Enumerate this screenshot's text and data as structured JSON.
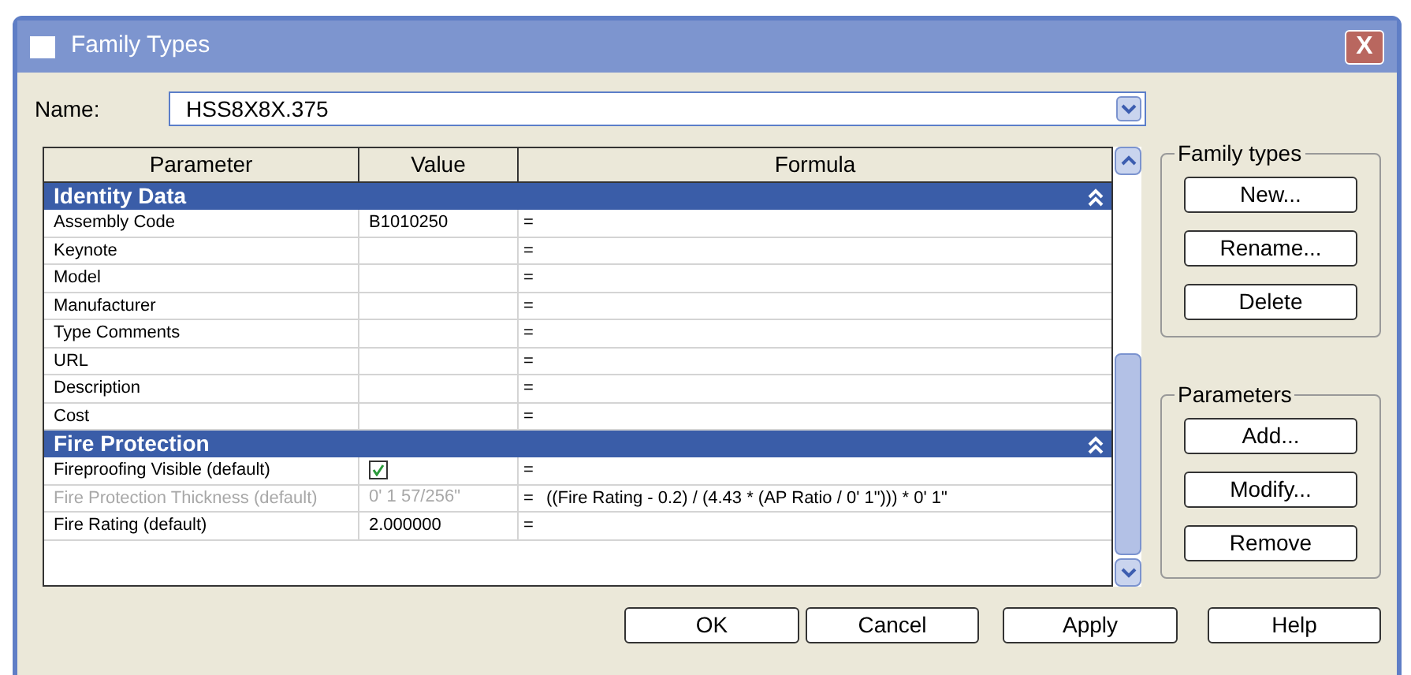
{
  "window": {
    "title": "Family Types",
    "close": "X"
  },
  "name_field": {
    "label": "Name:",
    "value": "HSS8X8X.375"
  },
  "table": {
    "columns": [
      "Parameter",
      "Value",
      "Formula"
    ],
    "groups": [
      {
        "title": "Identity Data",
        "expanded": true,
        "rows": [
          {
            "kind": "text",
            "parameter": "Assembly Code",
            "value": "B1010250",
            "formula": "=",
            "disabled": false
          },
          {
            "kind": "text",
            "parameter": "Keynote",
            "formula": "=",
            "disabled": false
          },
          {
            "kind": "text",
            "parameter": "Model",
            "formula": "=",
            "disabled": false
          },
          {
            "kind": "text",
            "parameter": "Manufacturer",
            "formula": "=",
            "disabled": false
          },
          {
            "kind": "text",
            "parameter": "Type Comments",
            "formula": "=",
            "disabled": false
          },
          {
            "kind": "text",
            "parameter": "URL",
            "formula": "=",
            "disabled": false
          },
          {
            "kind": "text",
            "parameter": "Description",
            "formula": "=",
            "disabled": false
          },
          {
            "kind": "text",
            "parameter": "Cost",
            "formula": "=",
            "disabled": false
          }
        ]
      },
      {
        "title": "Fire Protection",
        "expanded": true,
        "rows": [
          {
            "kind": "checkbox",
            "parameter": "Fireproofing Visible (default)",
            "checked": true,
            "formula": "=",
            "disabled": false
          },
          {
            "kind": "text",
            "parameter": "Fire Protection Thickness (default)",
            "value": "0' 1 57/256\"",
            "formula": "=",
            "expression": "((Fire Rating - 0.2) / (4.43 * (AP Ratio / 0' 1\"))) * 0' 1\"",
            "disabled": true
          },
          {
            "kind": "text",
            "parameter": "Fire Rating (default)",
            "value": "2.000000",
            "formula": "=",
            "disabled": false
          }
        ]
      }
    ]
  },
  "family_types": {
    "title": "Family types",
    "buttons": [
      "New...",
      "Rename...",
      "Delete"
    ]
  },
  "parameters": {
    "title": "Parameters",
    "buttons": [
      "Add...",
      "Modify...",
      "Remove"
    ]
  },
  "buttons": [
    "OK",
    "Cancel",
    "Apply",
    "Help"
  ]
}
